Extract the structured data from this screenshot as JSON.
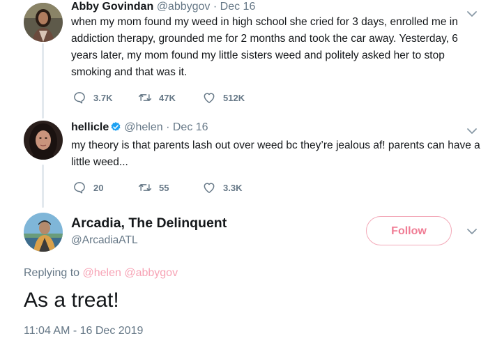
{
  "tweet1": {
    "name": "Abby Govindan",
    "handle": "@abbygov",
    "sep": "·",
    "date": "Dec 16",
    "text": "when my mom found my weed in high school she cried for 3 days, enrolled me in addiction therapy, grounded me for 2 months and took the car away. Yesterday, 6 years later, my mom found my little sisters weed and politely asked her to stop smoking and that was it.",
    "replies": "3.7K",
    "retweets": "47K",
    "likes": "512K"
  },
  "tweet2": {
    "name": "hellicle",
    "handle": "@helen",
    "sep": "·",
    "date": "Dec 16",
    "text": "my theory is that parents lash out over weed bc they’re jealous af! parents can have a little weed...",
    "replies": "20",
    "retweets": "55",
    "likes": "3.3K"
  },
  "main_tweet": {
    "name": "Arcadia, The Delinquent",
    "handle": "@ArcadiaATL",
    "follow_label": "Follow",
    "replying_label": "Replying to",
    "mention1": "@helen",
    "mention2": "@abbygov",
    "text": "As a treat!",
    "timestamp": "11:04 AM - 16 Dec 2019"
  },
  "colors": {
    "accent_pink": "#f07c94",
    "verified_blue": "#1da1f2",
    "muted": "#657786"
  },
  "icons": {
    "reply": "reply-icon",
    "retweet": "retweet-icon",
    "like": "heart-icon",
    "caret": "chevron-down-icon",
    "verified": "verified-badge-icon"
  }
}
